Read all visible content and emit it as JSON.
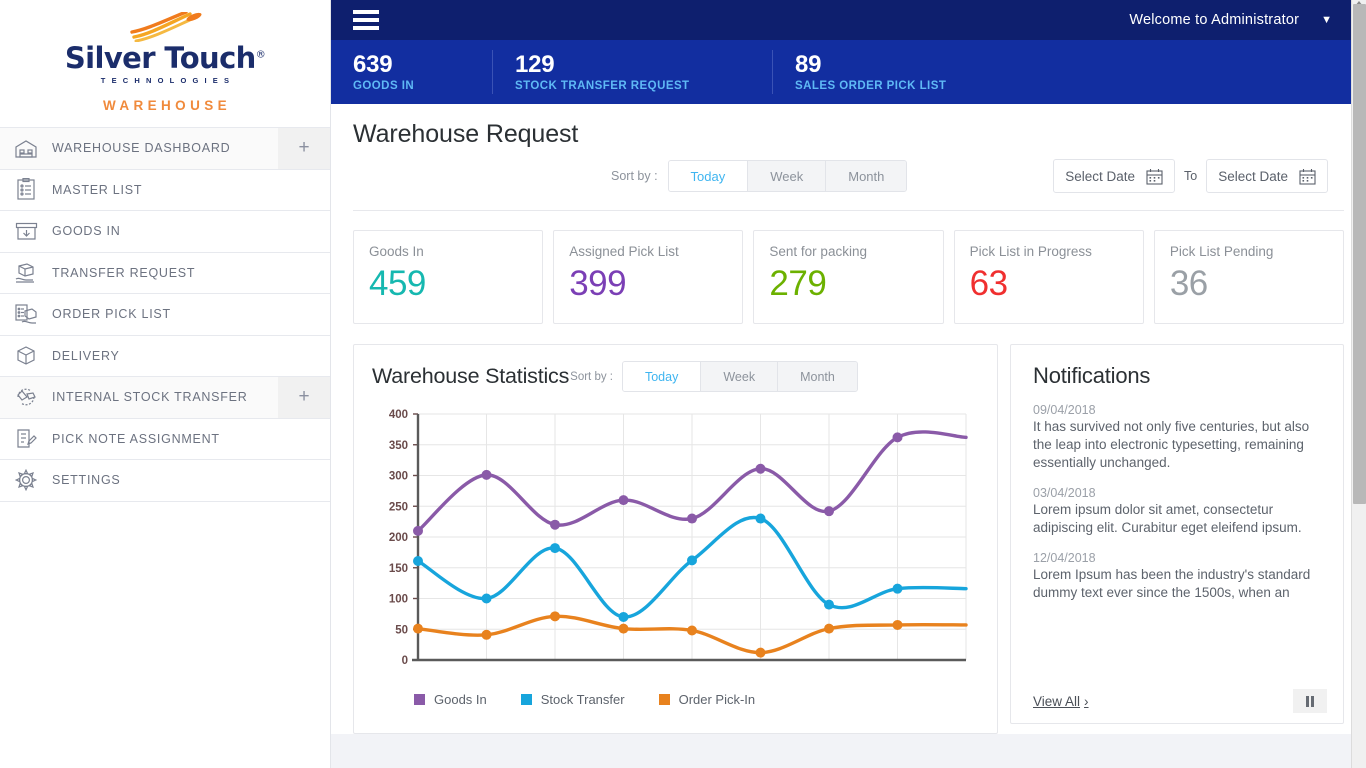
{
  "brand": {
    "name": "Silver Touch",
    "trademark": "®",
    "sub": "TECHNOLOGIES",
    "product": "WAREHOUSE"
  },
  "sidebar": {
    "items": [
      {
        "label": "WAREHOUSE DASHBOARD",
        "icon": "warehouse-icon",
        "expandable": true,
        "active": true
      },
      {
        "label": "MASTER LIST",
        "icon": "clipboard-list-icon",
        "expandable": false,
        "active": false
      },
      {
        "label": "GOODS IN",
        "icon": "box-arrow-down-icon",
        "expandable": false,
        "active": false
      },
      {
        "label": "TRANSFER REQUEST",
        "icon": "box-hand-icon",
        "expandable": false,
        "active": false
      },
      {
        "label": "ORDER PICK LIST",
        "icon": "clipboard-box-icon",
        "expandable": false,
        "active": false
      },
      {
        "label": "DELIVERY",
        "icon": "package-icon",
        "expandable": false,
        "active": false
      },
      {
        "label": "INTERNAL STOCK TRANSFER",
        "icon": "stock-transfer-icon",
        "expandable": true,
        "active": true
      },
      {
        "label": "PICK NOTE ASSIGNMENT",
        "icon": "note-edit-icon",
        "expandable": false,
        "active": false
      },
      {
        "label": "SETTINGS",
        "icon": "gear-icon",
        "expandable": false,
        "active": false
      }
    ],
    "expand_symbol": "+"
  },
  "topbar": {
    "welcome": "Welcome to Administrator",
    "caret": "▼"
  },
  "statbar": {
    "stats": [
      {
        "value": "639",
        "label": "GOODS IN"
      },
      {
        "value": "129",
        "label": "STOCK TRANSFER REQUEST"
      },
      {
        "value": "89",
        "label": "SALES ORDER PICK LIST"
      }
    ]
  },
  "page": {
    "title": "Warehouse Request",
    "sort_by_label": "Sort by :",
    "range_tabs": [
      {
        "label": "Today",
        "active": true
      },
      {
        "label": "Week",
        "active": false
      },
      {
        "label": "Month",
        "active": false
      }
    ],
    "date_from_placeholder": "Select Date",
    "date_to_placeholder": "Select Date",
    "to_label": "To"
  },
  "kpis": [
    {
      "label": "Goods In",
      "value": "459",
      "color": "#16b8b0"
    },
    {
      "label": "Assigned Pick List",
      "value": "399",
      "color": "#7b3fb5"
    },
    {
      "label": "Sent for packing",
      "value": "279",
      "color": "#6cb100"
    },
    {
      "label": "Pick List in Progress",
      "value": "63",
      "color": "#f02f2f"
    },
    {
      "label": "Pick List Pending",
      "value": "36",
      "color": "#9aa0a6"
    }
  ],
  "chart_panel": {
    "sort_by_label": "Sort by :",
    "range_tabs": [
      {
        "label": "Today",
        "active": true
      },
      {
        "label": "Week",
        "active": false
      },
      {
        "label": "Month",
        "active": false
      }
    ]
  },
  "chart_data": {
    "type": "line",
    "title": "Warehouse Statistics",
    "xlabel": "",
    "ylabel": "",
    "ylim": [
      0,
      400
    ],
    "yticks": [
      0,
      50,
      100,
      150,
      200,
      250,
      300,
      350,
      400
    ],
    "grid": true,
    "legend_position": "bottom",
    "x": [
      1,
      2,
      3,
      4,
      5,
      6,
      7,
      8,
      9
    ],
    "series": [
      {
        "name": "Goods In",
        "color": "#8a5aa8",
        "values": [
          210,
          301,
          220,
          260,
          230,
          311,
          242,
          362,
          362
        ]
      },
      {
        "name": "Stock Transfer",
        "color": "#17a5dc",
        "values": [
          161,
          100,
          182,
          70,
          162,
          230,
          90,
          116,
          116
        ]
      },
      {
        "name": "Order Pick-In",
        "color": "#e8821e",
        "values": [
          51,
          41,
          71,
          51,
          48,
          12,
          51,
          57,
          57
        ]
      }
    ]
  },
  "notifications": {
    "title": "Notifications",
    "items": [
      {
        "date": "09/04/2018",
        "text": "It has survived not only five centuries, but also the leap into electronic typesetting, remaining essentially unchanged."
      },
      {
        "date": "03/04/2018",
        "text": "Lorem ipsum dolor sit amet, consectetur adipiscing elit. Curabitur eget eleifend ipsum."
      },
      {
        "date": "12/04/2018",
        "text": "Lorem Ipsum has been the industry's standard dummy text ever since the 1500s, when an"
      }
    ],
    "view_all": "View All",
    "view_all_arrow": "›"
  }
}
